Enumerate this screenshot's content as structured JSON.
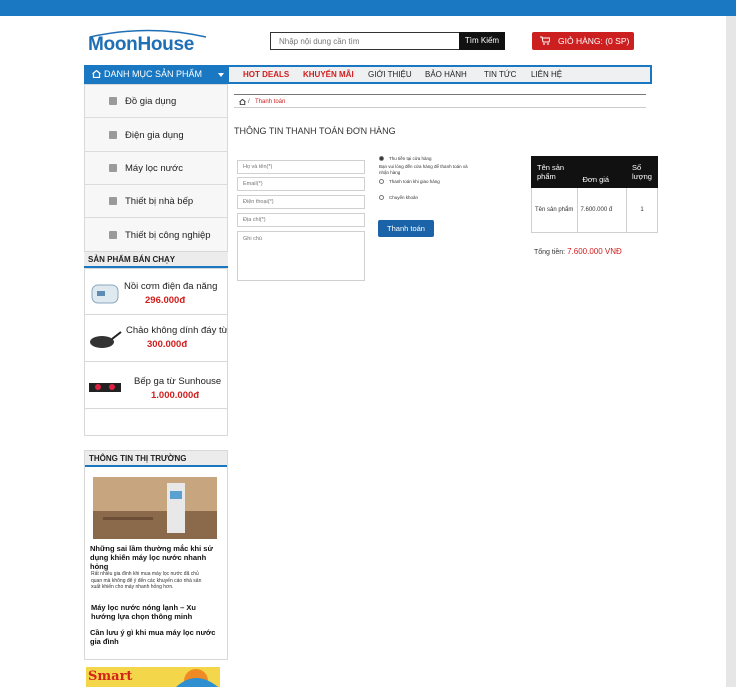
{
  "header": {
    "logo": "MoonHouse",
    "search_placeholder": "Nhập nội dung cần tìm",
    "search_button": "Tìm Kiếm",
    "cart_label": "GIỎ HÀNG: (0 SP)"
  },
  "nav": {
    "category_button": "DANH MỤC SẢN PHẨM",
    "items": [
      "HOT DEALS",
      "KHUYẾN MÃI",
      "GIỚI THIỆU",
      "BẢO HÀNH",
      "TIN TỨC",
      "LIÊN HỆ"
    ]
  },
  "sidebar": {
    "categories": [
      "Đồ gia dụng",
      "Điện gia dụng",
      "Máy lọc nước",
      "Thiết bị nhà bếp",
      "Thiết bị công nghiệp"
    ],
    "bestseller_title": "SẢN PHẨM BÁN CHẠY",
    "products": [
      {
        "name": "Nồi cơm điện đa năng",
        "price": "296.000đ"
      },
      {
        "name": "Chảo không dính đáy từ",
        "price": "300.000đ"
      },
      {
        "name": "Bếp ga từ Sunhouse",
        "price": "1.000.000đ"
      }
    ],
    "news_title": "THÔNG TIN THỊ TRƯỜNG",
    "news": [
      {
        "title": "Những sai lầm thường mắc khi sử dụng khiến máy lọc nước nhanh hỏng",
        "excerpt": "Rất nhiều gia đình khi mua máy lọc nước đã chủ quan mà không để ý đến các khuyến cáo nhà sản xuất khiến cho máy nhanh hỏng hơn."
      },
      {
        "title": "Máy lọc nước nóng lạnh – Xu hướng lựa chọn thông minh"
      },
      {
        "title": "Cần lưu ý gì khi mua máy lọc nước gia đình"
      }
    ],
    "banner_text": "Smart"
  },
  "breadcrumb": {
    "current": "Thanh toán",
    "separator": "/"
  },
  "page_title": "THÔNG TIN THANH TOÁN ĐƠN HÀNG",
  "form": {
    "name_placeholder": "Họ và tên(*)",
    "email_placeholder": "Email(*)",
    "phone_placeholder": "Điện thoại(*)",
    "address_placeholder": "Địa chỉ(*)",
    "note_placeholder": "Ghi chú"
  },
  "payment": {
    "options": [
      {
        "label": "Thu tiền tại cửa hàng",
        "note": "Bạn vui lòng đến cửa hàng để thanh toán và nhận hàng",
        "selected": true
      },
      {
        "label": "Thanh toán khi giao hàng",
        "selected": false
      },
      {
        "label": "Chuyển khoản",
        "selected": false
      }
    ],
    "submit": "Thanh toán"
  },
  "cart_table": {
    "headers": [
      "Tên sản phẩm",
      "Đơn giá",
      "Số lượng"
    ],
    "rows": [
      [
        "Tên sản phẩm",
        "7.600.000 đ",
        "1"
      ]
    ]
  },
  "total": {
    "label": "Tổng tiền:",
    "value": "7.600.000 VNĐ"
  },
  "colors": {
    "brand": "#1a78c2",
    "accent": "#d21d1d",
    "cart": "#cc1f1f"
  }
}
